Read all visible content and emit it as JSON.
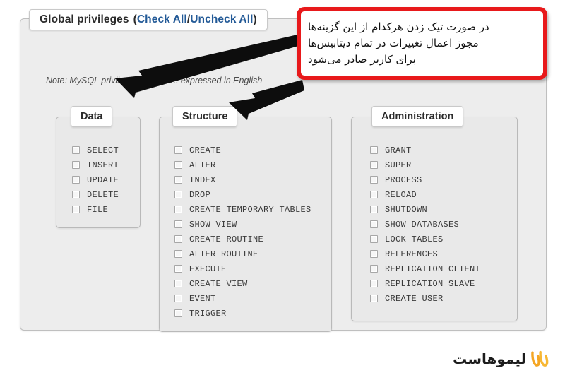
{
  "panel": {
    "legend_prefix": "Global privileges",
    "legend_open": "(",
    "check_all": "Check All",
    "separator": " / ",
    "uncheck_all": "Uncheck All",
    "legend_close": ")",
    "note": "Note: MySQL privilege names are expressed in English"
  },
  "columns": [
    {
      "id": "data",
      "title": "Data",
      "items": [
        {
          "label": "SELECT",
          "checked": false
        },
        {
          "label": "INSERT",
          "checked": false
        },
        {
          "label": "UPDATE",
          "checked": false
        },
        {
          "label": "DELETE",
          "checked": false
        },
        {
          "label": "FILE",
          "checked": false
        }
      ]
    },
    {
      "id": "structure",
      "title": "Structure",
      "items": [
        {
          "label": "CREATE",
          "checked": false
        },
        {
          "label": "ALTER",
          "checked": false
        },
        {
          "label": "INDEX",
          "checked": false
        },
        {
          "label": "DROP",
          "checked": false
        },
        {
          "label": "CREATE TEMPORARY TABLES",
          "checked": false
        },
        {
          "label": "SHOW VIEW",
          "checked": false
        },
        {
          "label": "CREATE ROUTINE",
          "checked": false
        },
        {
          "label": "ALTER ROUTINE",
          "checked": false
        },
        {
          "label": "EXECUTE",
          "checked": false
        },
        {
          "label": "CREATE VIEW",
          "checked": false
        },
        {
          "label": "EVENT",
          "checked": false
        },
        {
          "label": "TRIGGER",
          "checked": false
        }
      ]
    },
    {
      "id": "administration",
      "title": "Administration",
      "items": [
        {
          "label": "GRANT",
          "checked": false
        },
        {
          "label": "SUPER",
          "checked": false
        },
        {
          "label": "PROCESS",
          "checked": false
        },
        {
          "label": "RELOAD",
          "checked": false
        },
        {
          "label": "SHUTDOWN",
          "checked": false
        },
        {
          "label": "SHOW DATABASES",
          "checked": false
        },
        {
          "label": "LOCK TABLES",
          "checked": false
        },
        {
          "label": "REFERENCES",
          "checked": false
        },
        {
          "label": "REPLICATION CLIENT",
          "checked": false
        },
        {
          "label": "REPLICATION SLAVE",
          "checked": false
        },
        {
          "label": "CREATE USER",
          "checked": false
        }
      ]
    }
  ],
  "callout": {
    "line1": "در صورت تیک زدن هرکدام از این گزینه‌ها",
    "line2": "مجوز اعمال تغییرات در تمام دیتابیس‌ها",
    "line3": "برای کاربر صادر می‌شود",
    "border_color": "#e8191b"
  },
  "annotations": {
    "arrow_color": "#0d0d0d",
    "arrow_count": 2
  },
  "footer": {
    "brand_name": "لیموهاست",
    "brand_color": "#f5a623"
  }
}
